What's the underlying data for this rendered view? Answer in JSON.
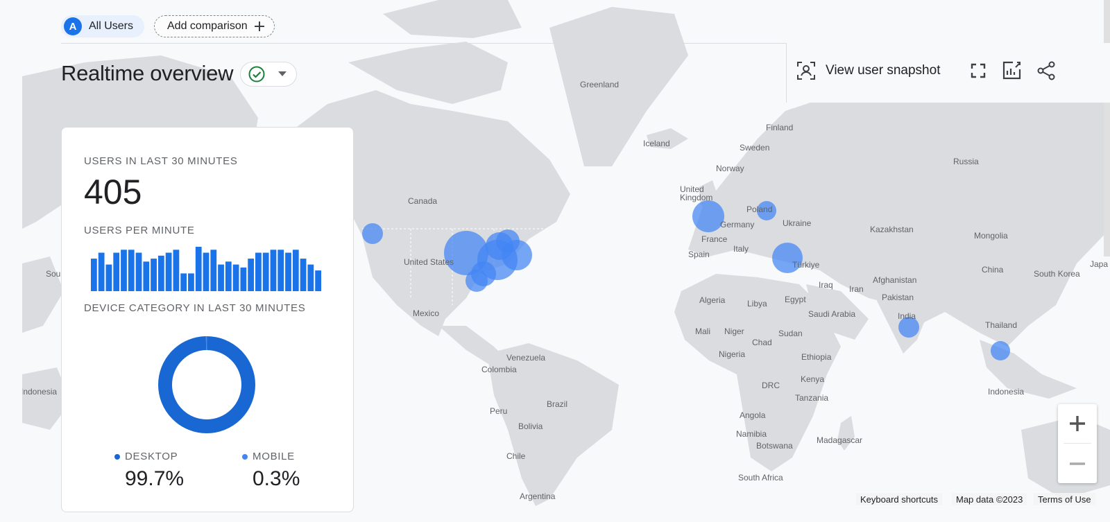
{
  "segment": {
    "avatar_letter": "A",
    "label": "All Users"
  },
  "add_comparison": {
    "label": "Add comparison"
  },
  "page": {
    "title": "Realtime overview"
  },
  "toolbar": {
    "snapshot_label": "View user snapshot"
  },
  "card": {
    "users_heading": "USERS IN LAST 30 MINUTES",
    "users_value": "405",
    "per_minute_heading": "USERS PER MINUTE",
    "per_minute_values": [
      11,
      13,
      9,
      13,
      14,
      14,
      13,
      10,
      11,
      12,
      13,
      14,
      6,
      6,
      15,
      13,
      14,
      9,
      10,
      9,
      8,
      11,
      13,
      13,
      14,
      14,
      13,
      14,
      11,
      9,
      7
    ],
    "device_heading": "DEVICE CATEGORY IN LAST 30 MINUTES",
    "device_data": [
      {
        "label": "DESKTOP",
        "value": "99.7%",
        "share": 0.997,
        "color": "#1967d2"
      },
      {
        "label": "MOBILE",
        "value": "0.3%",
        "share": 0.003,
        "color": "#4285f4"
      }
    ]
  },
  "map": {
    "labels": [
      {
        "text": "Greenland"
      },
      {
        "text": "Iceland"
      },
      {
        "text": "Finland"
      },
      {
        "text": "Sweden"
      },
      {
        "text": "Norway"
      },
      {
        "text": "Russia"
      },
      {
        "text": "United Kingdom"
      },
      {
        "text": "Poland"
      },
      {
        "text": "Germany"
      },
      {
        "text": "Ukraine"
      },
      {
        "text": "France"
      },
      {
        "text": "Kazakhstan"
      },
      {
        "text": "Mongolia"
      },
      {
        "text": "Spain"
      },
      {
        "text": "Italy"
      },
      {
        "text": "Türkiye"
      },
      {
        "text": "China"
      },
      {
        "text": "South Korea"
      },
      {
        "text": "Japa"
      },
      {
        "text": "Afghanistan"
      },
      {
        "text": "Iraq"
      },
      {
        "text": "Iran"
      },
      {
        "text": "Pakistan"
      },
      {
        "text": "India"
      },
      {
        "text": "Thailand"
      },
      {
        "text": "Canada"
      },
      {
        "text": "United States"
      },
      {
        "text": "Mexico"
      },
      {
        "text": "Algeria"
      },
      {
        "text": "Libya"
      },
      {
        "text": "Egypt"
      },
      {
        "text": "Saudi Arabia"
      },
      {
        "text": "Mali"
      },
      {
        "text": "Niger"
      },
      {
        "text": "Sudan"
      },
      {
        "text": "Chad"
      },
      {
        "text": "Nigeria"
      },
      {
        "text": "Ethiopia"
      },
      {
        "text": "Kenya"
      },
      {
        "text": "DRC"
      },
      {
        "text": "Tanzania"
      },
      {
        "text": "Angola"
      },
      {
        "text": "Namibia"
      },
      {
        "text": "Botswana"
      },
      {
        "text": "Madagascar"
      },
      {
        "text": "South Africa"
      },
      {
        "text": "Venezuela"
      },
      {
        "text": "Colombia"
      },
      {
        "text": "Brazil"
      },
      {
        "text": "Peru"
      },
      {
        "text": "Bolivia"
      },
      {
        "text": "Chile"
      },
      {
        "text": "Argentina"
      },
      {
        "text": "Indonesia"
      },
      {
        "text": "Indonesia"
      },
      {
        "text": "Sou"
      }
    ],
    "attribution": {
      "keyboard_shortcuts": "Keyboard shortcuts",
      "map_data": "Map data ©2023",
      "terms": "Terms of Use"
    }
  },
  "colors": {
    "accent": "#1a73e8",
    "bubble": "#4285f4",
    "status_ok": "#188038"
  },
  "icons": [
    "segment-avatar",
    "plus-icon",
    "check-circle-icon",
    "caret-down-icon",
    "user-snapshot-icon",
    "fullscreen-icon",
    "customize-report-icon",
    "share-icon",
    "zoom-in-icon",
    "zoom-out-icon"
  ]
}
